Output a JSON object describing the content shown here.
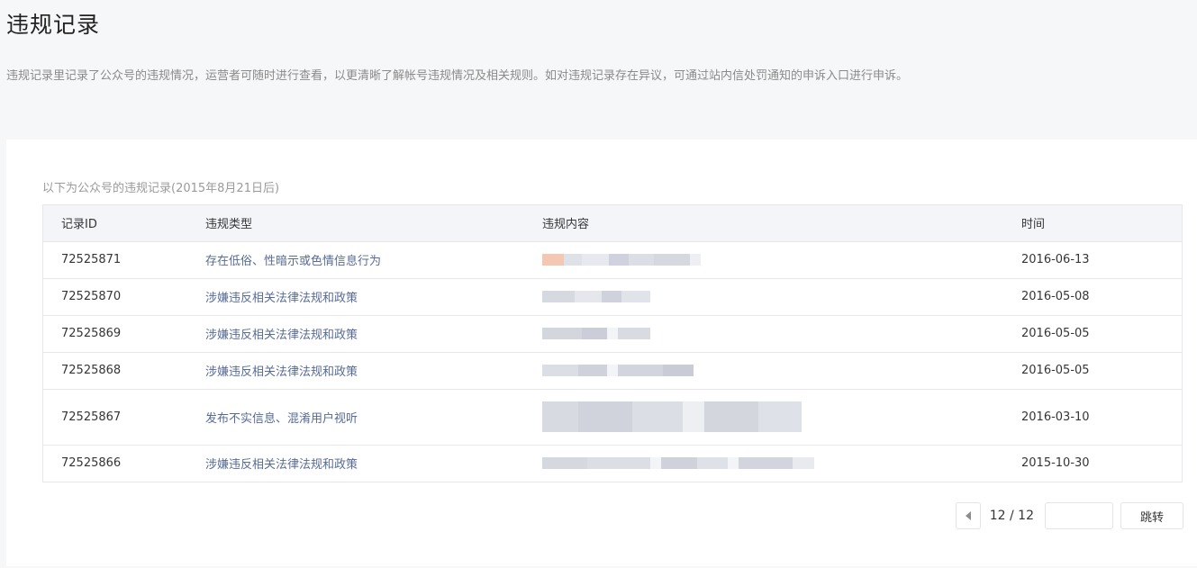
{
  "page": {
    "title": "违规记录",
    "description": "违规记录里记录了公众号的违规情况，运营者可随时进行查看，以更清晰了解帐号违规情况及相关规则。如对违规记录存在异议，可通过站内信处罚通知的申诉入口进行申诉。"
  },
  "records": {
    "caption": "以下为公众号的违规记录(2015年8月21日后)",
    "headers": {
      "id": "记录ID",
      "type": "违规类型",
      "content": "违规内容",
      "time": "时间"
    },
    "rows": [
      {
        "id": "72525871",
        "type": "存在低俗、性暗示或色情信息行为",
        "time": "2016-06-13"
      },
      {
        "id": "72525870",
        "type": "涉嫌违反相关法律法规和政策",
        "time": "2016-05-08"
      },
      {
        "id": "72525869",
        "type": "涉嫌违反相关法律法规和政策",
        "time": "2016-05-05"
      },
      {
        "id": "72525868",
        "type": "涉嫌违反相关法律法规和政策",
        "time": "2016-05-05"
      },
      {
        "id": "72525867",
        "type": "发布不实信息、混淆用户视听",
        "time": "2016-03-10"
      },
      {
        "id": "72525866",
        "type": "涉嫌违反相关法律法规和政策",
        "time": "2015-10-30"
      }
    ]
  },
  "pagination": {
    "page_text": "12 / 12",
    "jump_input_value": "",
    "jump_label": "跳转"
  },
  "colors": {
    "link_text": "#576b95",
    "blur_gray": "#cfd2dc",
    "blur_accent": "#f2c8b2"
  },
  "icons": {
    "prev": "caret-left-icon"
  }
}
